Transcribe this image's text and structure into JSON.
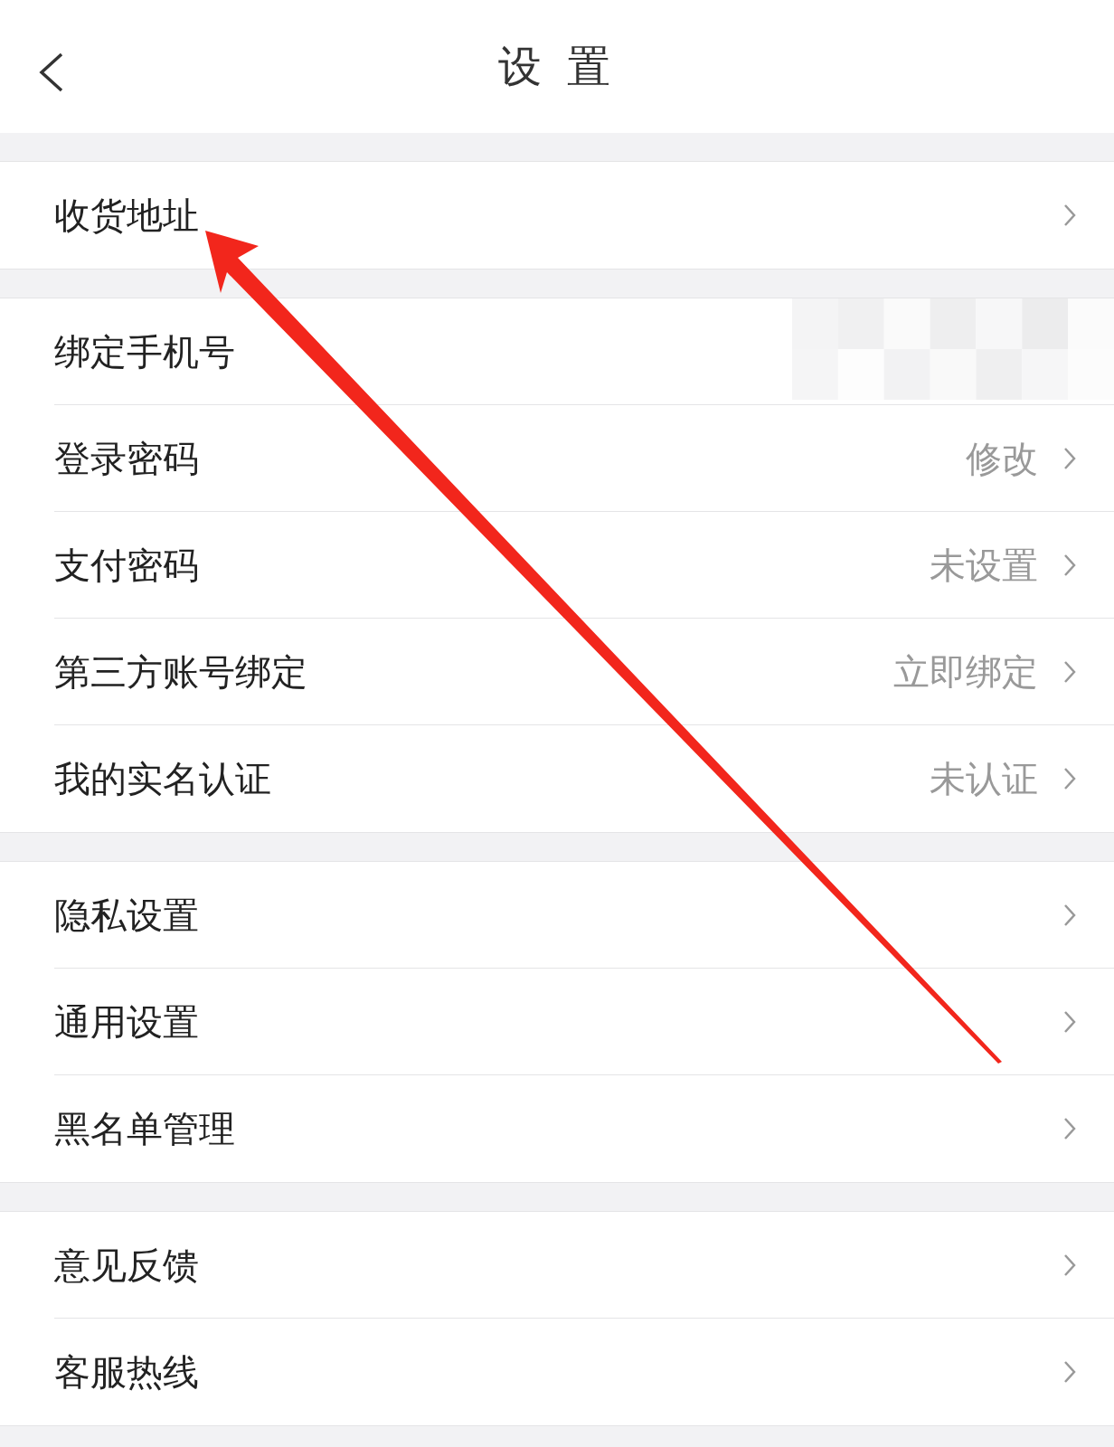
{
  "header": {
    "title": "设 置"
  },
  "groups": [
    {
      "rows": [
        {
          "label": "收货地址",
          "chevron": true
        }
      ]
    },
    {
      "rows": [
        {
          "label": "绑定手机号",
          "chevron": false,
          "masked": true
        },
        {
          "label": "登录密码",
          "value": "修改",
          "chevron": true
        },
        {
          "label": "支付密码",
          "value": "未设置",
          "chevron": true
        },
        {
          "label": "第三方账号绑定",
          "value": "立即绑定",
          "chevron": true
        },
        {
          "label": "我的实名认证",
          "value": "未认证",
          "chevron": true
        }
      ]
    },
    {
      "rows": [
        {
          "label": "隐私设置",
          "chevron": true
        },
        {
          "label": "通用设置",
          "chevron": true
        },
        {
          "label": "黑名单管理",
          "chevron": true
        }
      ]
    },
    {
      "rows": [
        {
          "label": "意见反馈",
          "chevron": true
        },
        {
          "label": "客服热线",
          "chevron": true
        }
      ]
    }
  ],
  "annotation": {
    "kind": "arrow"
  }
}
